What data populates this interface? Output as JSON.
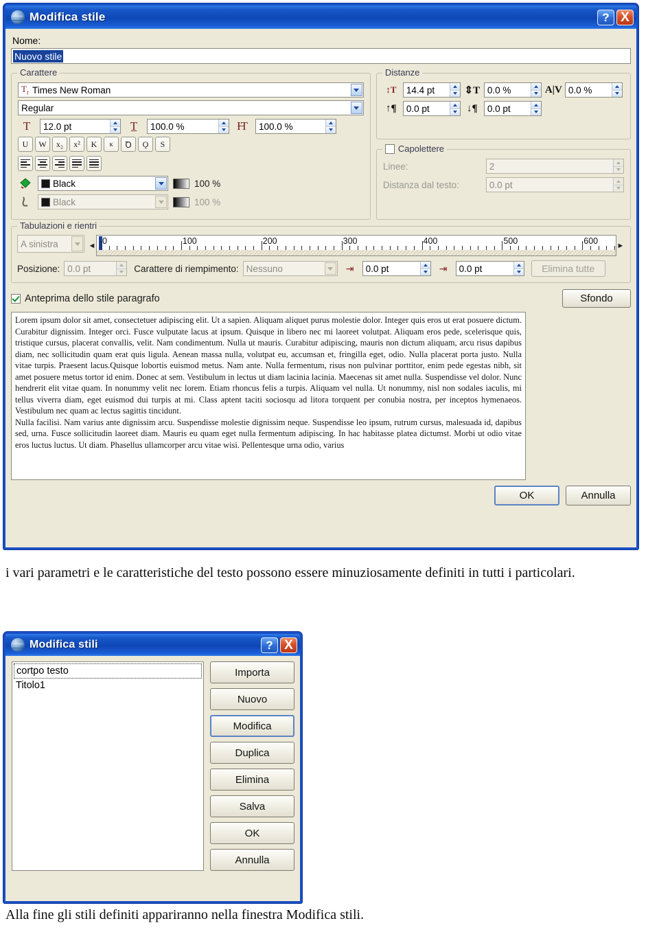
{
  "dialog_style": {
    "title": "Modifica stile",
    "window_icon": "globe-icon",
    "help_button": "?",
    "close_button": "X",
    "name_label": "Nome:",
    "name_value": "Nuovo stile",
    "font_group": {
      "legend": "Carattere",
      "font_family": "Times New Roman",
      "font_family_icon": "truetype-icon",
      "font_style": "Regular",
      "font_size": "12.0 pt",
      "font_size_icon": "font-size-icon",
      "width_scale": "100.0 %",
      "width_scale_icon": "horizontal-scale-icon",
      "height_scale": "100.0 %",
      "height_scale_icon": "vertical-scale-icon",
      "format_buttons": [
        {
          "name": "underline-button",
          "glyph": "U"
        },
        {
          "name": "double-underline-button",
          "glyph": "W"
        },
        {
          "name": "subscript-button",
          "glyph": "x₂"
        },
        {
          "name": "superscript-button",
          "glyph": "x²"
        },
        {
          "name": "capitals-button",
          "glyph": "K"
        },
        {
          "name": "small-capitals-button",
          "glyph": "ĸ"
        },
        {
          "name": "outline-button",
          "glyph": "Ꝺ"
        },
        {
          "name": "shadow-button",
          "glyph": "Ǫ"
        },
        {
          "name": "strikethrough-button",
          "glyph": "S"
        }
      ],
      "align_buttons": [
        {
          "name": "align-left-button"
        },
        {
          "name": "align-center-button"
        },
        {
          "name": "align-right-button"
        },
        {
          "name": "align-justify-button"
        },
        {
          "name": "align-force-justify-button"
        }
      ],
      "fill_color": "Black",
      "fill_color_icon": "fill-color-icon",
      "fill_opacity": "100 %",
      "stroke_color": "Black",
      "stroke_color_icon": "stroke-color-icon",
      "stroke_opacity": "100 %"
    },
    "spacing_group": {
      "legend": "Distanze",
      "line_spacing": "14.4 pt",
      "line_spacing_icon": "line-spacing-icon",
      "vertical_scale": "0.0 %",
      "vertical_scale_icon": "text-height-icon",
      "kerning": "0.0 %",
      "kerning_icon": "kerning-av-icon",
      "space_before": "0.0 pt",
      "space_before_icon": "space-before-paragraph-icon",
      "space_after": "0.0 pt",
      "space_after_icon": "space-after-paragraph-icon"
    },
    "dropcaps_group": {
      "legend": "Capolettere",
      "checked": false,
      "lines_label": "Linee:",
      "lines_value": "2",
      "distance_label": "Distanza dal testo:",
      "distance_value": "0.0 pt"
    },
    "tabs_group": {
      "legend": "Tabulazioni e rientri",
      "tab_type": "A sinistra",
      "ruler_ticks": [
        0,
        100,
        200,
        300,
        400,
        500,
        600
      ],
      "ruler_min": 0,
      "ruler_max": 640,
      "position_label": "Posizione:",
      "position_value": "0.0 pt",
      "leader_label": "Carattere di riempimento:",
      "leader_value": "Nessuno",
      "indent_first_value": "0.0 pt",
      "indent_first_icon": "first-line-indent-icon",
      "indent_left_value": "0.0 pt",
      "indent_left_icon": "left-indent-icon",
      "clear_all_button": "Elimina tutte"
    },
    "preview_checkbox_label": "Anteprima dello stile paragrafo",
    "preview_checkbox_checked": true,
    "background_button": "Sfondo",
    "preview_text": "Lorem ipsum dolor sit amet, consectetuer adipiscing elit. Ut a sapien. Aliquam aliquet purus molestie dolor. Integer quis eros ut erat posuere dictum. Curabitur dignissim. Integer orci. Fusce vulputate lacus at ipsum. Quisque in libero nec mi laoreet volutpat. Aliquam eros pede, scelerisque quis, tristique cursus, placerat convallis, velit. Nam condimentum. Nulla ut mauris. Curabitur adipiscing, mauris non dictum aliquam, arcu risus dapibus diam, nec sollicitudin quam erat quis ligula. Aenean massa nulla, volutpat eu, accumsan et, fringilla eget, odio. Nulla placerat porta justo. Nulla vitae turpis. Praesent lacus.Quisque lobortis euismod metus. Nam ante. Nulla fermentum, risus non pulvinar porttitor, enim pede egestas nibh, sit amet posuere metus tortor id enim. Donec at sem. Vestibulum in lectus ut diam lacinia lacinia. Maecenas sit amet nulla. Suspendisse vel dolor. Nunc hendrerit elit vitae quam. In nonummy velit nec lorem. Etiam rhoncus felis a turpis. Aliquam vel nulla. Ut nonummy, nisl non sodales iaculis, mi tellus viverra diam, eget euismod dui turpis at mi. Class aptent taciti sociosqu ad litora torquent per conubia nostra, per inceptos hymenaeos. Vestibulum nec quam ac lectus sagittis tincidunt.",
    "preview_text_2": "Nulla facilisi. Nam varius ante dignissim arcu. Suspendisse molestie dignissim neque. Suspendisse leo ipsum, rutrum cursus, malesuada id, dapibus sed, urna. Fusce sollicitudin laoreet diam. Mauris eu quam eget nulla fermentum adipiscing. In hac habitasse platea dictumst. Morbi ut odio vitae eros luctus luctus. Ut diam. Phasellus ullamcorper arcu vitae wisi. Pellentesque urna odio, varius",
    "ok_button": "OK",
    "cancel_button": "Annulla"
  },
  "caption_top": "i vari parametri e le caratteristiche del testo possono essere minuziosamente definiti in tutti i particolari.",
  "caption_bottom": "Alla fine gli stili definiti appariranno nella finestra Modifica stili.",
  "dialog_styles": {
    "title": "Modifica stili",
    "window_icon": "globe-icon",
    "help_button": "?",
    "close_button": "X",
    "list_items": [
      "cortpo testo",
      "Titolo1"
    ],
    "buttons": [
      {
        "name": "import-button",
        "label": "Importa",
        "default": false
      },
      {
        "name": "new-button",
        "label": "Nuovo",
        "default": false
      },
      {
        "name": "modify-button",
        "label": "Modifica",
        "default": true
      },
      {
        "name": "duplicate-button",
        "label": "Duplica",
        "default": false
      },
      {
        "name": "delete-button",
        "label": "Elimina",
        "default": false
      },
      {
        "name": "save-button",
        "label": "Salva",
        "default": false
      },
      {
        "name": "ok-button",
        "label": "OK",
        "default": false
      },
      {
        "name": "cancel-button",
        "label": "Annulla",
        "default": false
      }
    ]
  },
  "colors": {
    "titlebar_blue": "#0e47b5",
    "dialog_face": "#ece9d8",
    "selection_blue": "#18439c",
    "close_red": "#d8502a"
  }
}
